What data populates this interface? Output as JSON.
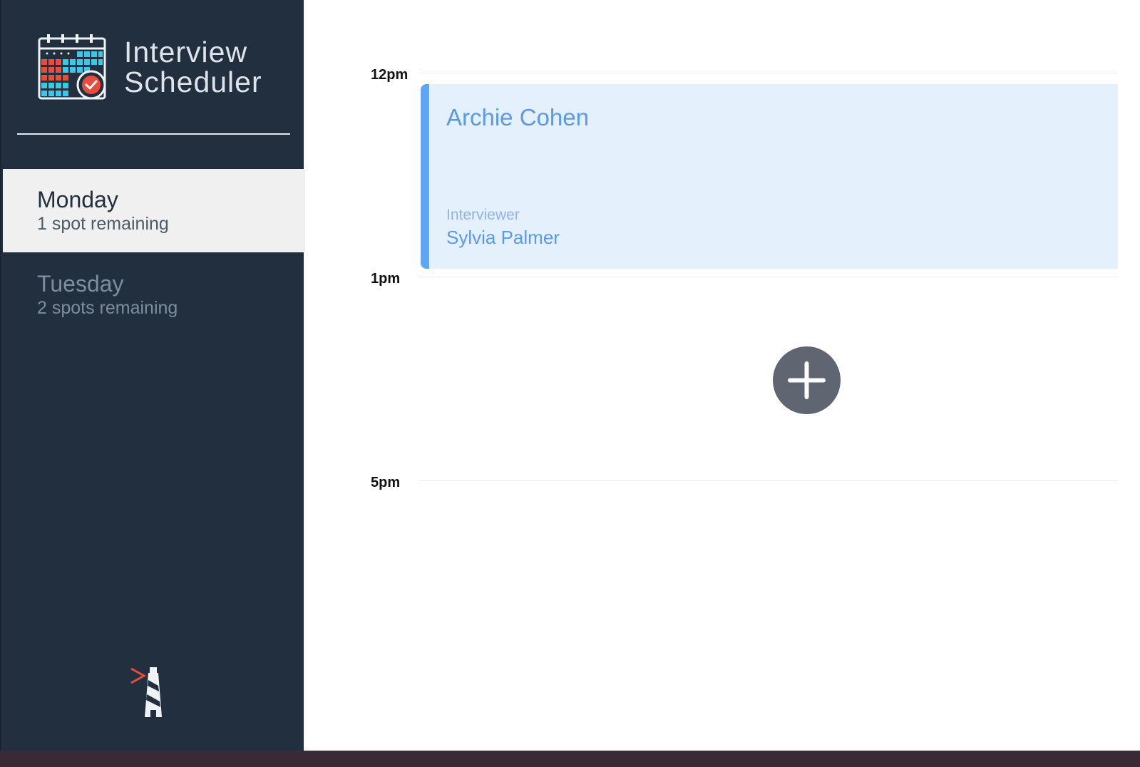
{
  "app": {
    "title_line1": "Interview",
    "title_line2": "Scheduler"
  },
  "sidebar": {
    "days": [
      {
        "name": "Monday",
        "spots": "1 spot remaining",
        "selected": true
      },
      {
        "name": "Tuesday",
        "spots": "2 spots remaining",
        "selected": false
      }
    ]
  },
  "schedule": {
    "times": [
      "12pm",
      "1pm",
      "5pm"
    ],
    "appointment": {
      "student": "Archie Cohen",
      "interviewer_label": "Interviewer",
      "interviewer_name": "Sylvia Palmer"
    }
  },
  "icons": {
    "logo": "calendar-check-icon",
    "add": "plus-icon",
    "footer": "lighthouse-icon"
  },
  "colors": {
    "sidebar_bg": "#222f3e",
    "accent_blue": "#5da5f5",
    "appointment_bg": "#e5f0fd",
    "add_button": "#5f6571",
    "check_red": "#e74c3c"
  }
}
